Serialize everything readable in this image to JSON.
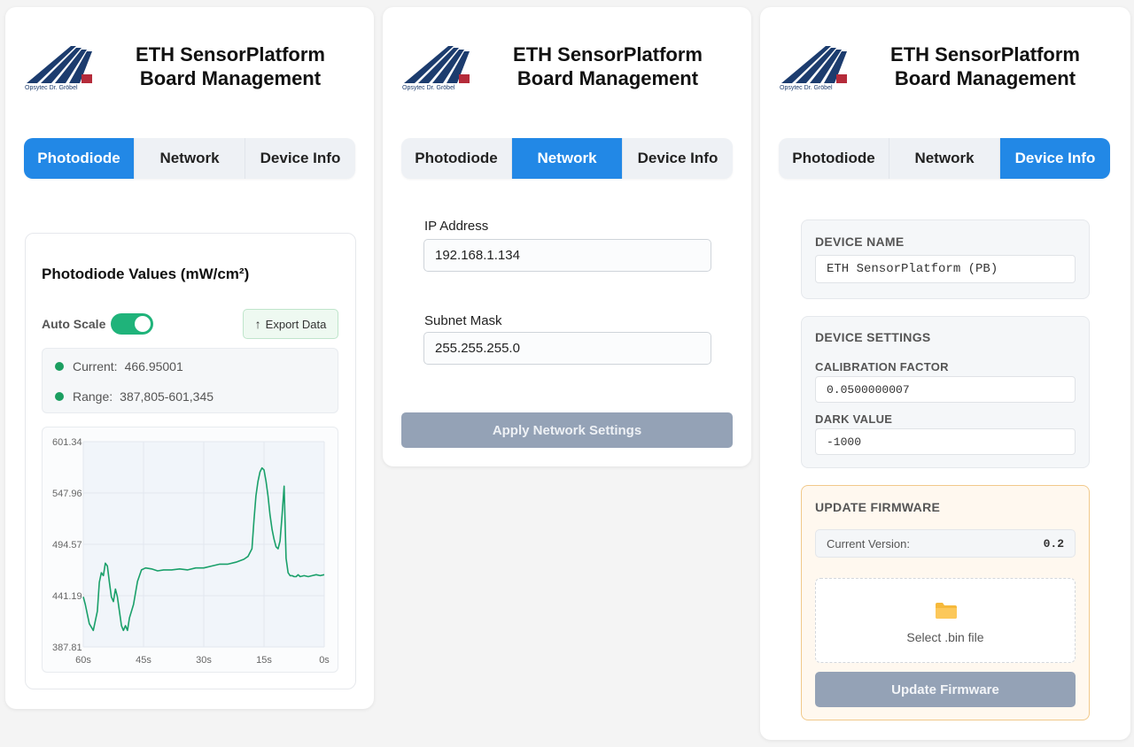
{
  "brand": {
    "logo_text": "Opsytec Dr. Gröbel",
    "title_line1": "ETH SensorPlatform",
    "title_line2": "Board Management",
    "colors": {
      "accent": "#2288e6",
      "success": "#1fb37a",
      "logo_blue": "#1c3c6e",
      "logo_red": "#b52b3a"
    }
  },
  "tabs": [
    "Photodiode",
    "Network",
    "Device Info"
  ],
  "photodiode": {
    "title": "Photodiode Values (mW/cm²)",
    "auto_scale_label": "Auto Scale",
    "auto_scale_on": true,
    "export_label": "Export Data",
    "current_label": "Current:",
    "current_value": "466.95001",
    "range_label": "Range:",
    "range_value": "387,805-601,345"
  },
  "chart_data": {
    "type": "line",
    "y_ticks": [
      "601.34",
      "547.96",
      "494.57",
      "441.19",
      "387.81"
    ],
    "x_ticks": [
      "60s",
      "45s",
      "30s",
      "15s",
      "0s"
    ],
    "ylim": [
      387.81,
      601.34
    ],
    "xlim": [
      60,
      0
    ],
    "grid": true,
    "series": [
      {
        "color": "#1aa06a",
        "x": [
          60,
          59.5,
          58.5,
          57.5,
          56.5,
          56,
          55.5,
          55,
          54.5,
          54,
          53.5,
          53,
          52.5,
          52,
          51.5,
          51,
          50.5,
          50,
          49.5,
          49,
          48.5,
          47.5,
          46.5,
          45.5,
          44.5,
          43,
          41.5,
          40,
          38,
          36,
          34,
          32,
          30,
          28,
          26,
          24,
          22,
          20,
          19,
          18,
          17.5,
          17,
          16.5,
          16,
          15.5,
          15,
          14.5,
          14,
          13.5,
          13,
          12.5,
          12,
          11.5,
          11,
          10.5,
          10,
          9.5,
          9,
          8.5,
          8,
          7.5,
          7,
          6.5,
          6,
          5,
          4,
          3,
          2,
          1,
          0
        ],
        "y": [
          440,
          432,
          412,
          405,
          425,
          455,
          465,
          462,
          475,
          472,
          455,
          440,
          435,
          448,
          440,
          425,
          410,
          405,
          410,
          405,
          418,
          432,
          456,
          468,
          470,
          469,
          467,
          468,
          468,
          469,
          468,
          470,
          470,
          472,
          474,
          474,
          476,
          479,
          482,
          490,
          520,
          545,
          560,
          570,
          574,
          572,
          560,
          545,
          525,
          510,
          500,
          492,
          490,
          498,
          525,
          555,
          480,
          465,
          462,
          462,
          461,
          461,
          463,
          461,
          462,
          461,
          462,
          463,
          462,
          463
        ]
      }
    ]
  },
  "network": {
    "ip_label": "IP Address",
    "ip_value": "192.168.1.134",
    "mask_label": "Subnet Mask",
    "mask_value": "255.255.255.0",
    "apply_label": "Apply Network Settings"
  },
  "device": {
    "name_heading": "DEVICE NAME",
    "name_value": "ETH SensorPlatform (PB)",
    "settings_heading": "DEVICE SETTINGS",
    "calib_label": "CALIBRATION FACTOR",
    "calib_value": "0.0500000007",
    "dark_label": "DARK VALUE",
    "dark_value": "-1000",
    "fw_heading": "UPDATE FIRMWARE",
    "current_version_label": "Current Version:",
    "current_version_value": "0.2",
    "select_file_label": "Select .bin file",
    "update_label": "Update Firmware"
  }
}
